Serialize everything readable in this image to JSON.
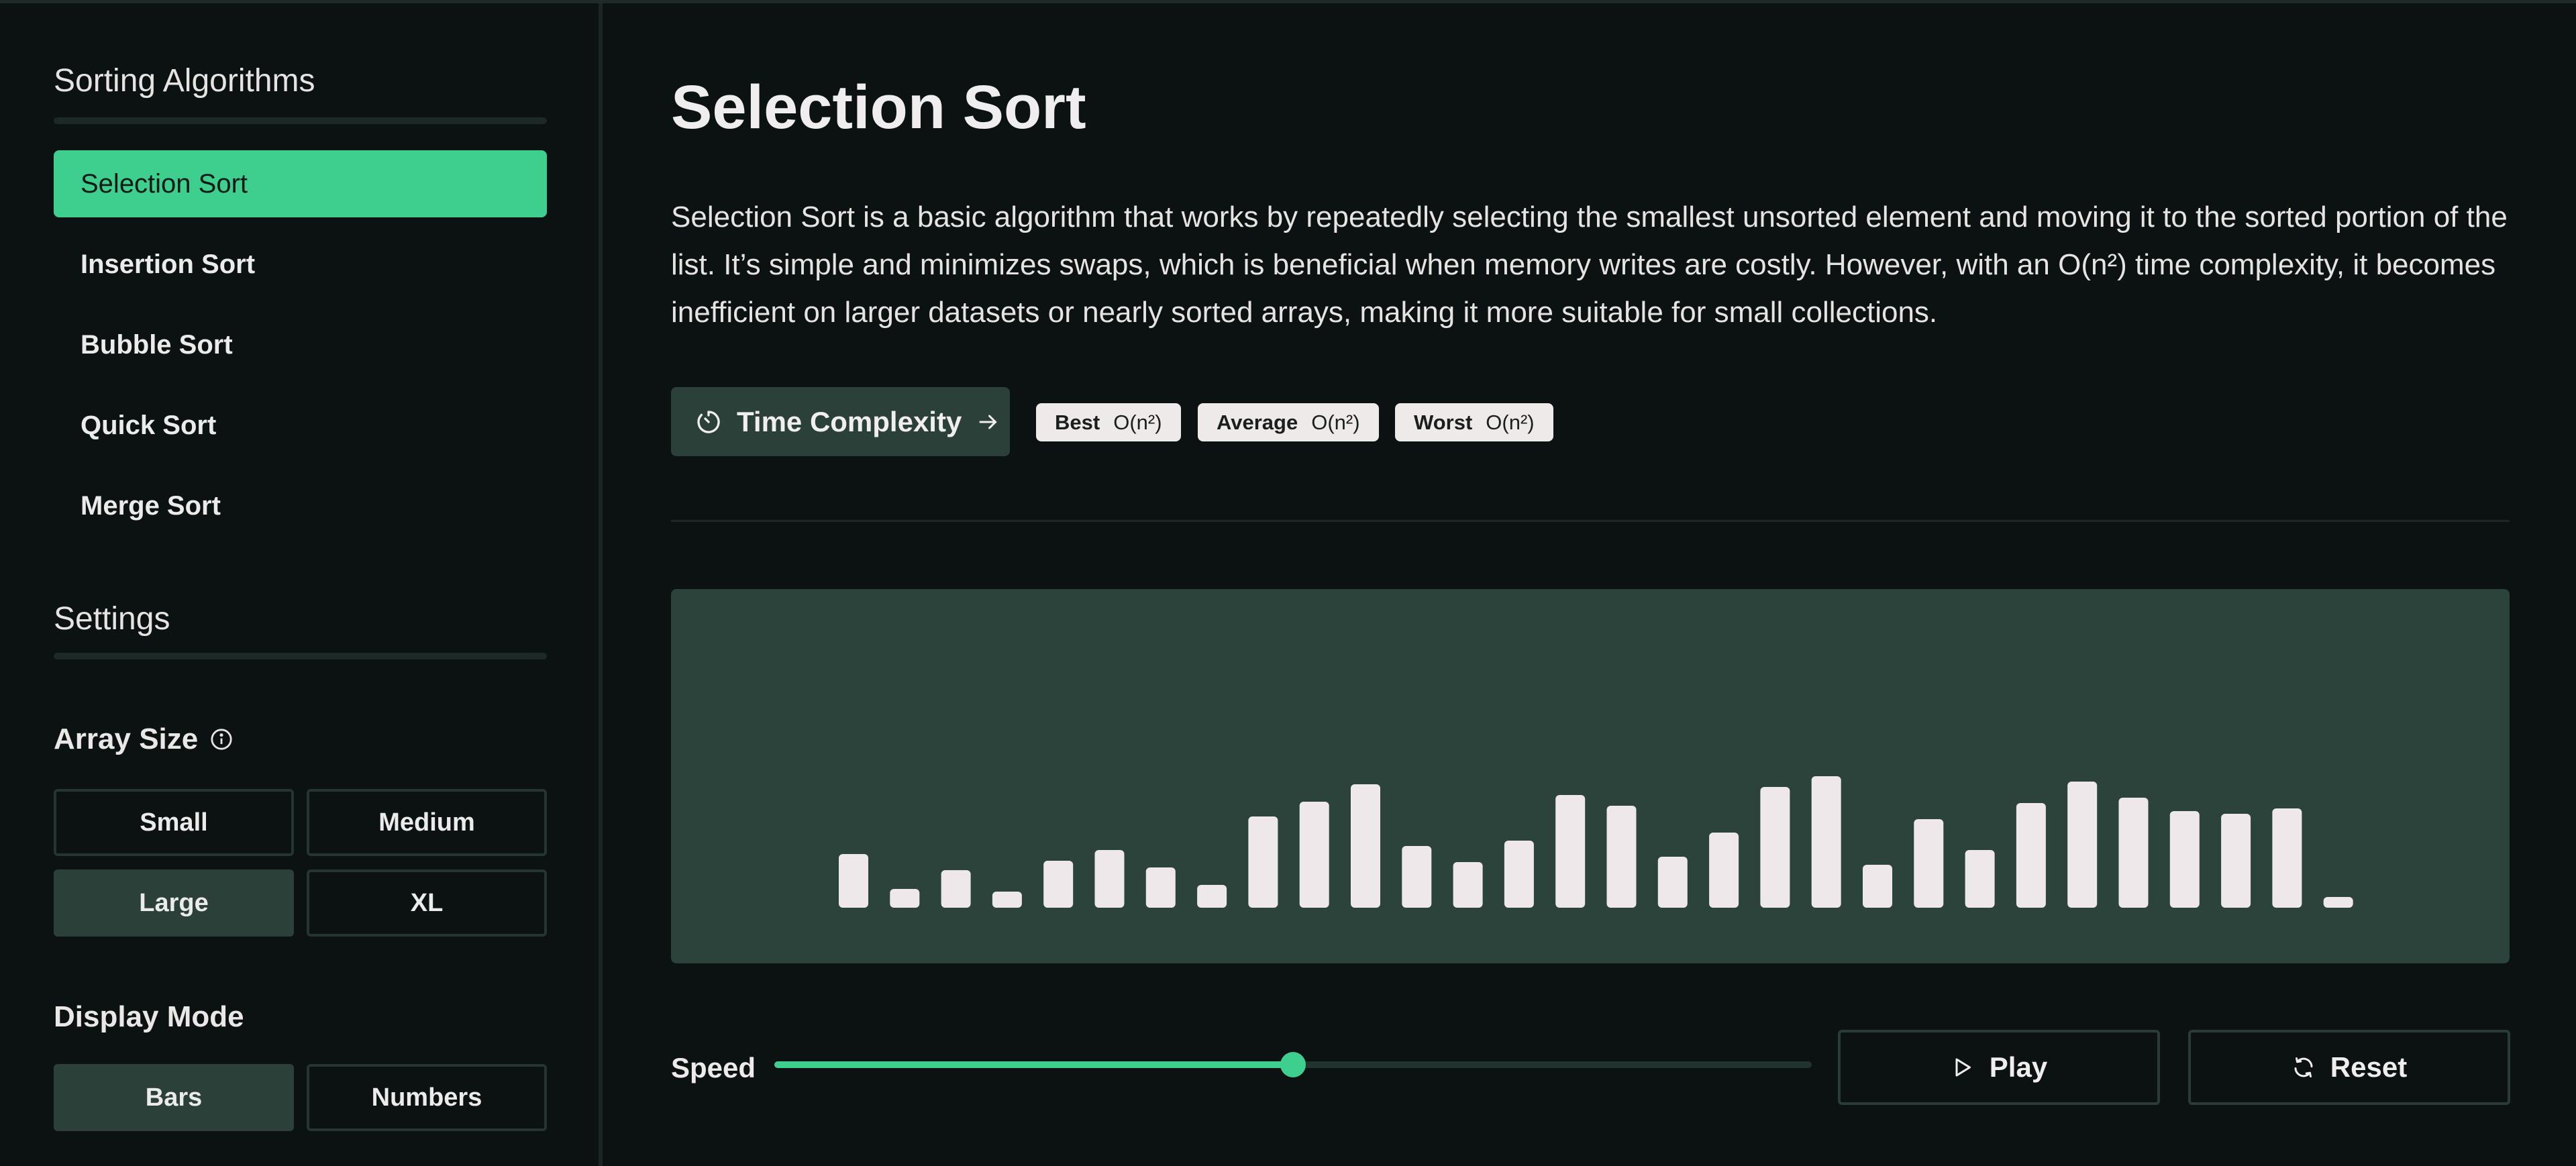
{
  "sidebar": {
    "algorithms_title": "Sorting Algorithms",
    "algorithms": [
      {
        "label": "Selection Sort",
        "active": true
      },
      {
        "label": "Insertion Sort",
        "active": false
      },
      {
        "label": "Bubble Sort",
        "active": false
      },
      {
        "label": "Quick Sort",
        "active": false
      },
      {
        "label": "Merge Sort",
        "active": false
      }
    ],
    "settings_title": "Settings",
    "array_size": {
      "label": "Array Size",
      "options": [
        {
          "label": "Small",
          "active": false
        },
        {
          "label": "Medium",
          "active": false
        },
        {
          "label": "Large",
          "active": true
        },
        {
          "label": "XL",
          "active": false
        }
      ]
    },
    "display_mode": {
      "label": "Display Mode",
      "options": [
        {
          "label": "Bars",
          "active": true
        },
        {
          "label": "Numbers",
          "active": false
        }
      ]
    }
  },
  "main": {
    "title": "Selection Sort",
    "description": "Selection Sort is a basic algorithm that works by repeatedly selecting the smallest unsorted element and moving it to the sorted portion of the list. It’s simple and minimizes swaps, which is beneficial when memory writes are costly. However, with an O(n²) time complexity, it becomes inefficient on larger datasets or nearly sorted arrays, making it more suitable for small collections.",
    "time_complexity_button": "Time Complexity",
    "complexities": [
      {
        "label": "Best",
        "value": "O(n²)"
      },
      {
        "label": "Average",
        "value": "O(n²)"
      },
      {
        "label": "Worst",
        "value": "O(n²)"
      }
    ],
    "array_values": [
      40,
      14,
      28,
      12,
      35,
      43,
      30,
      17,
      68,
      79,
      92,
      46,
      34,
      50,
      84,
      76,
      38,
      56,
      90,
      98,
      32,
      66,
      43,
      78,
      94,
      82,
      72,
      70,
      74,
      8
    ],
    "speed": {
      "label": "Speed",
      "value": 0.5
    },
    "play_label": "Play",
    "reset_label": "Reset"
  },
  "colors": {
    "accent": "#3ecf8e",
    "panel": "#2c433b",
    "bar": "#efe8ea",
    "background": "#0b1211"
  },
  "icons": {
    "info": "info-icon",
    "timer": "timer-icon",
    "arrow": "arrow-right-icon",
    "play": "play-icon",
    "reset": "refresh-icon"
  }
}
